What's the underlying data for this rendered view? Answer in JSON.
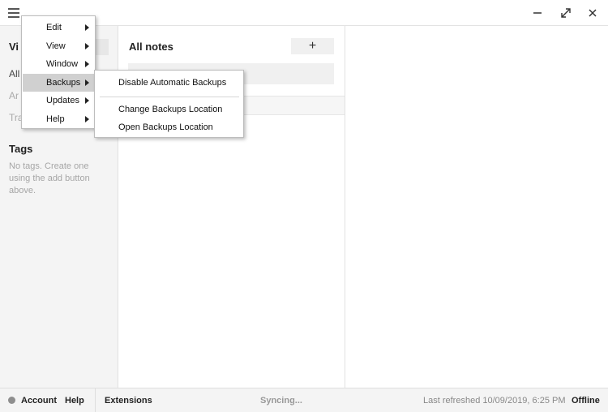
{
  "titlebar": {
    "menu_icon": "hamburger-icon",
    "minimize_icon": "minimize-icon",
    "maximize_icon": "maximize-icon",
    "close_icon": "close-icon"
  },
  "nav": {
    "views_title": "Vi",
    "all_item": "All",
    "archived_item": "Ar",
    "trash_item": "Tra",
    "tags_title": "Tags",
    "tags_empty": "No tags. Create one using the add button above."
  },
  "notes_list": {
    "title": "All notes",
    "add_label": "+",
    "search_placeholder": ""
  },
  "menu": {
    "items": [
      {
        "label": "Edit",
        "has_submenu": true
      },
      {
        "label": "View",
        "has_submenu": true
      },
      {
        "label": "Window",
        "has_submenu": true
      },
      {
        "label": "Backups",
        "has_submenu": true,
        "active": true
      },
      {
        "label": "Updates",
        "has_submenu": true
      },
      {
        "label": "Help",
        "has_submenu": true
      }
    ]
  },
  "backups_submenu": {
    "items": [
      {
        "label": "Disable Automatic Backups"
      },
      {
        "label": "Change Backups Location"
      },
      {
        "label": "Open Backups Location"
      }
    ]
  },
  "footer": {
    "account_label": "Account",
    "help_label": "Help",
    "extensions_label": "Extensions",
    "sync_status": "Syncing...",
    "last_refreshed": "Last refreshed 10/09/2019, 6:25 PM",
    "connection_status": "Offline"
  },
  "colors": {
    "panel_bg": "#f4f4f4",
    "menu_highlight": "#d0d0d0",
    "status_dot": "#8e8e8e"
  }
}
